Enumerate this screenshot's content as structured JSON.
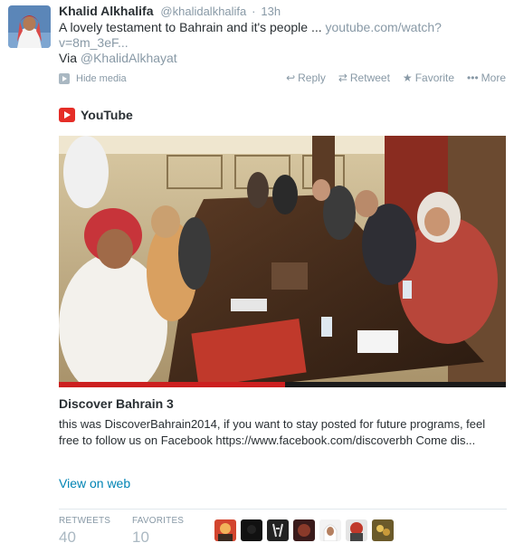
{
  "tweet": {
    "author_name": "Khalid Alkhalifa",
    "author_handle": "@khalidalkhalifa",
    "separator": "·",
    "time": "13h",
    "text": "A lovely testament to Bahrain and it's people ... ",
    "link_text": "youtube.com/watch?v=8m_3eF...",
    "via_prefix": "Via ",
    "via_handle": "@KhalidAlkhayat",
    "hide_media": "Hide media"
  },
  "actions": [
    {
      "label": "Reply",
      "icon": "reply-icon",
      "glyph": "↩"
    },
    {
      "label": "Retweet",
      "icon": "retweet-icon",
      "glyph": "⇄"
    },
    {
      "label": "Favorite",
      "icon": "star-icon",
      "glyph": "★"
    },
    {
      "label": "More",
      "icon": "more-icon",
      "glyph": "•••"
    }
  ],
  "card": {
    "source": "YouTube",
    "title": "Discover Bahrain 3",
    "description": "this was DiscoverBahrain2014, if you want to stay posted for future programs, feel free to follow us on Facebook https://www.facebook.com/discoverbh Come dis...",
    "view_link": "View on web"
  },
  "stats": {
    "retweets_label": "RETWEETS",
    "retweets_value": "40",
    "favorites_label": "FAVORITES",
    "favorites_value": "10"
  },
  "colors": {
    "muted": "#8899a6",
    "link": "#0084b4",
    "youtube_red": "#e52d27",
    "text": "#292f33"
  }
}
